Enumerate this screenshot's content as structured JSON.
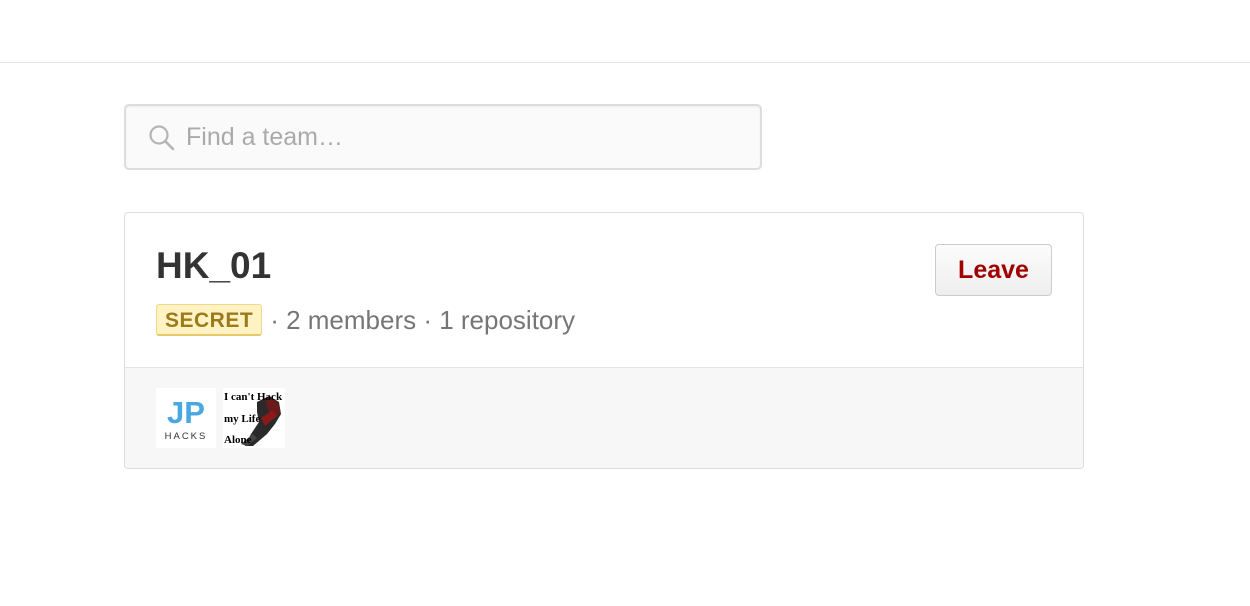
{
  "search": {
    "placeholder": "Find a team…",
    "value": ""
  },
  "team": {
    "name": "HK_01",
    "badge": "SECRET",
    "members_text": "· 2 members · 1 repository",
    "leave_label": "Leave",
    "avatars": [
      {
        "kind": "logo",
        "letters": "JP",
        "sub": "HACKS"
      },
      {
        "kind": "image",
        "lines": [
          "I can't Hack",
          "my Life",
          "Alone"
        ]
      }
    ]
  },
  "colors": {
    "badge_bg": "#fff3c4",
    "badge_text": "#9c7a1a",
    "leave_text": "#a00000",
    "jp_blue": "#4aa8e0"
  }
}
